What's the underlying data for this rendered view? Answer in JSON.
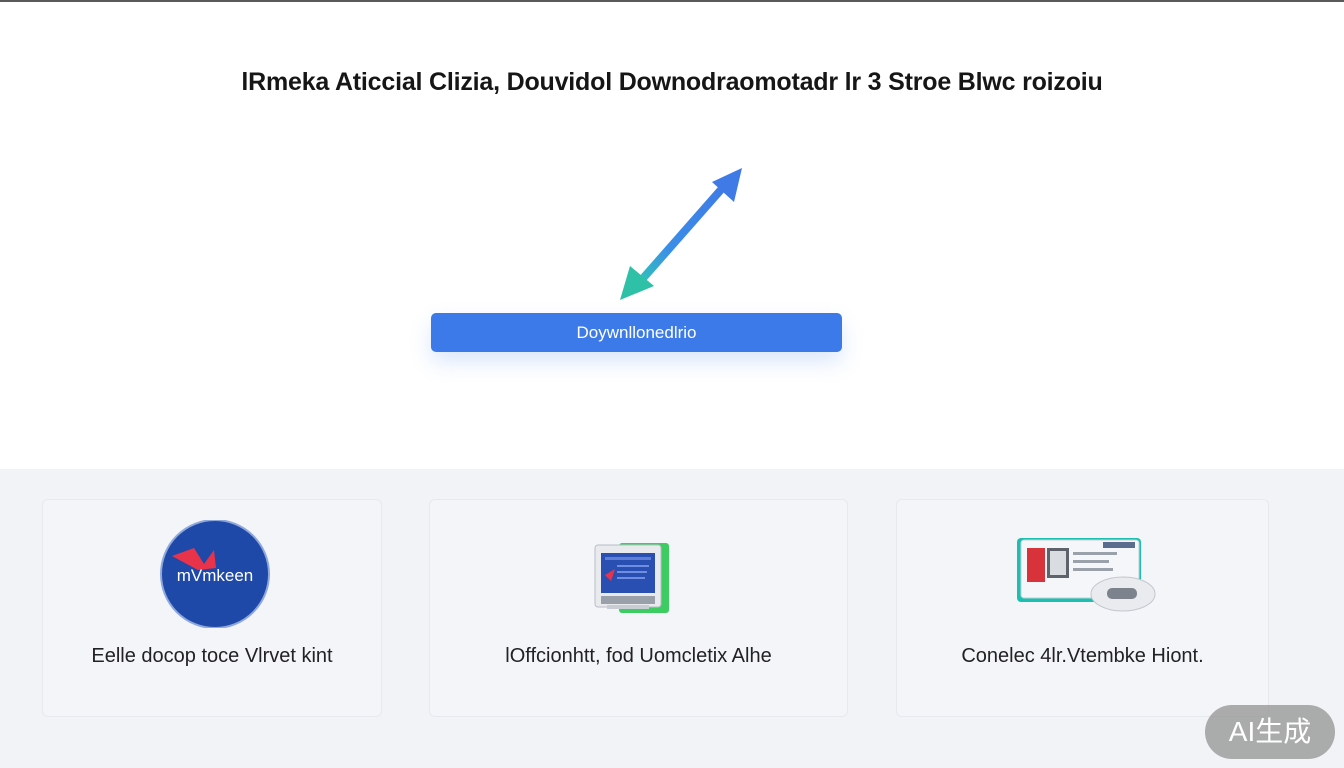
{
  "page": {
    "title": "lRmeka Aticcial Clizia, Douvidol Downodraomotadr lr 3 Stroe Blwc roizoiu"
  },
  "download": {
    "button_label": "Doywnllonedlrio"
  },
  "features": [
    {
      "label": "Eelle docop toce Vlrvet kint",
      "icon": "brand-logo-icon",
      "logo_text": "mVmkeen"
    },
    {
      "label": "lOffcionhtt, fod Uomcletix Alhe",
      "icon": "document-screen-icon"
    },
    {
      "label": "Conelec 4lr.Vtembke Hiont.",
      "icon": "card-device-icon"
    }
  ],
  "badge": {
    "label": "AI生成"
  },
  "colors": {
    "accent": "#3b7ae8",
    "section_bg": "#f1f3f7",
    "logo_blue": "#1f49a8",
    "logo_red": "#e8334a"
  }
}
